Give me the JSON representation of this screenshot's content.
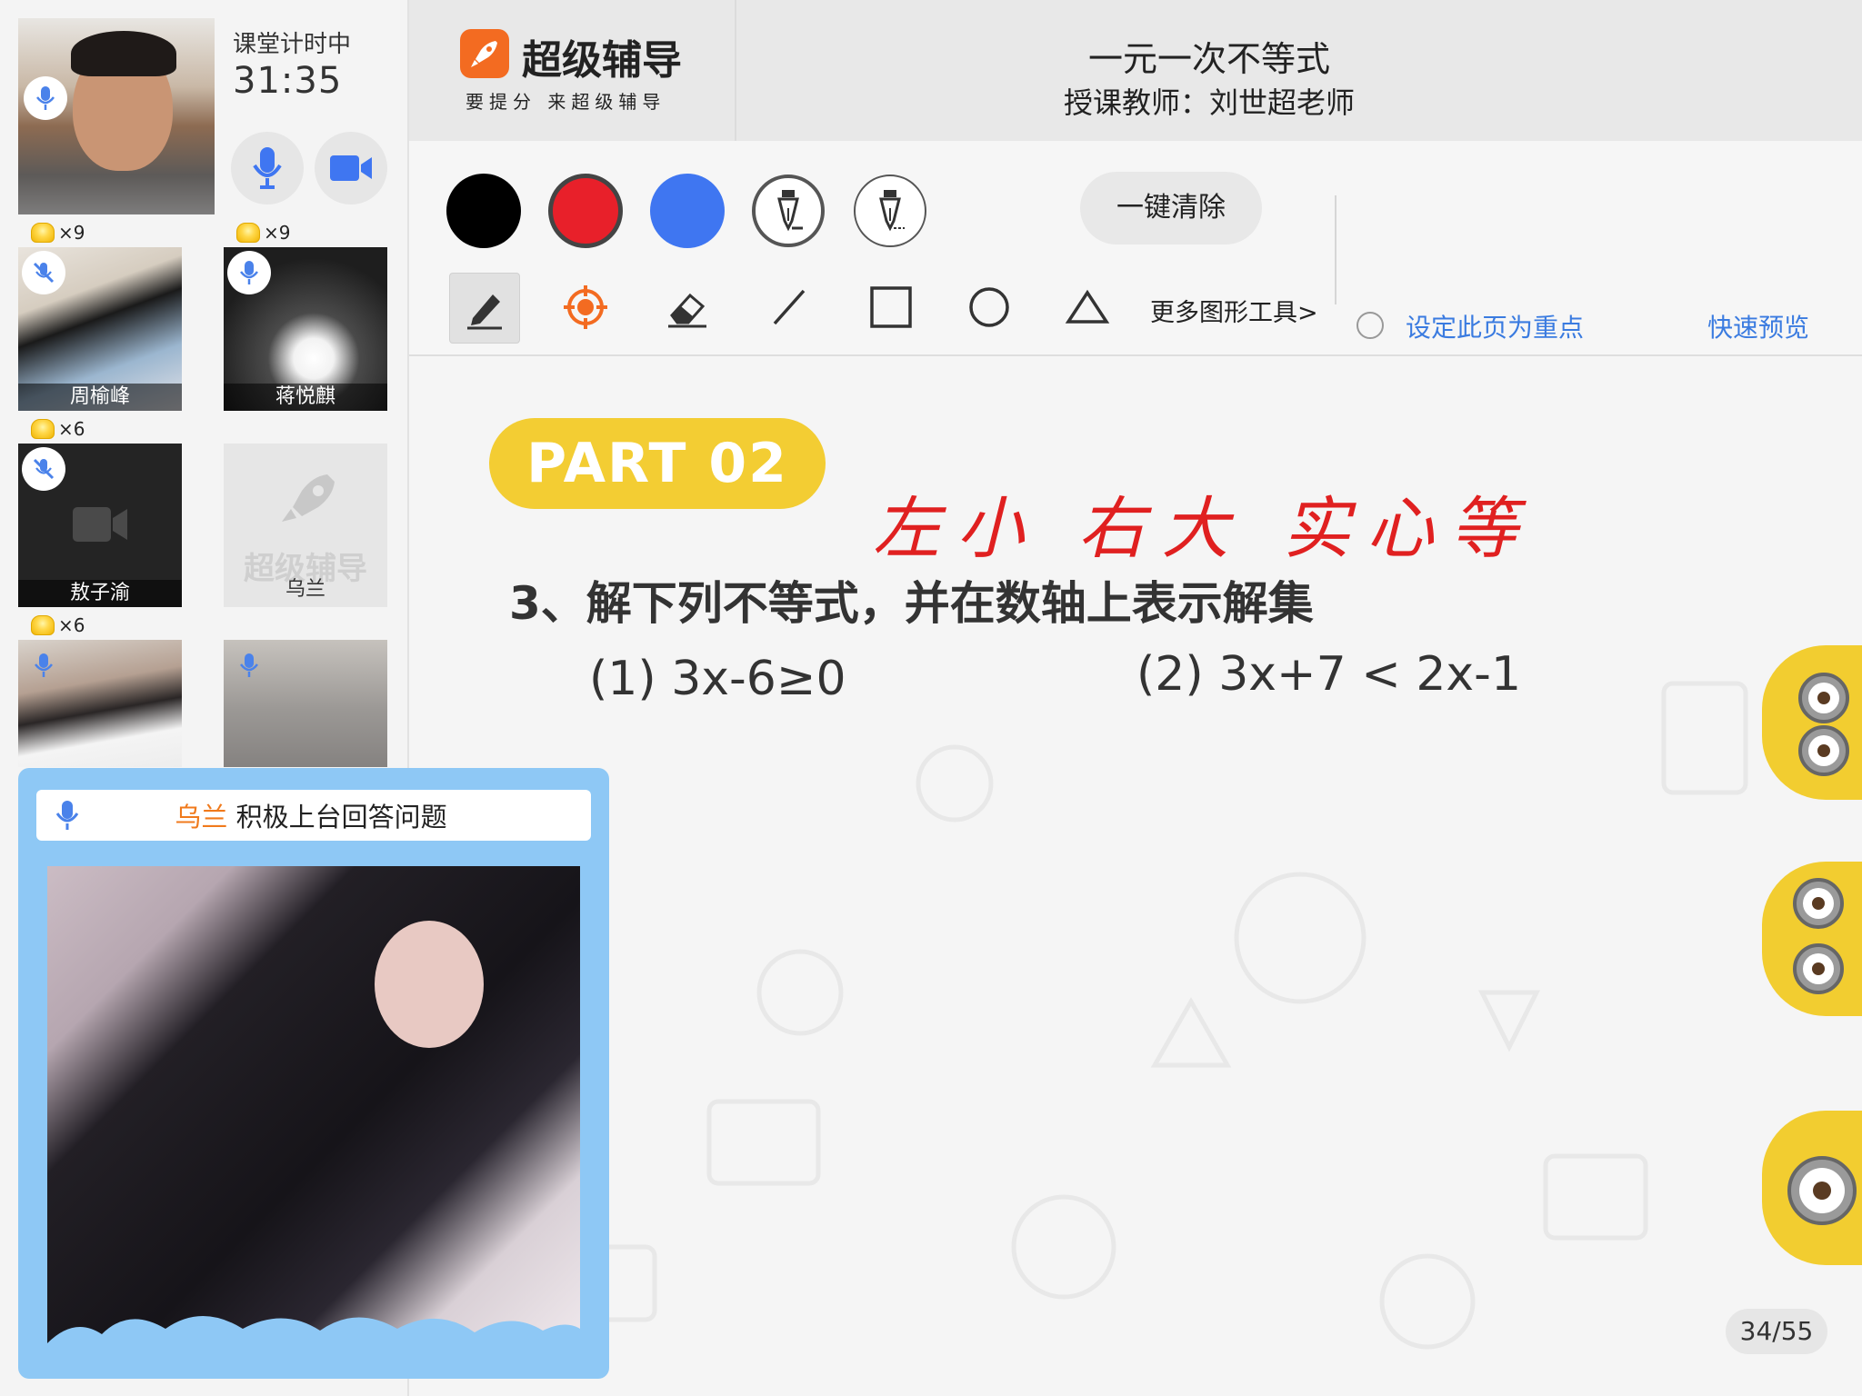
{
  "header": {
    "brand_name": "超级辅导",
    "brand_slogan": "要提分 来超级辅导",
    "lesson_title": "一元一次不等式",
    "teacher": "授课教师：刘世超老师"
  },
  "timer": {
    "label": "课堂计时中",
    "value": "31:35"
  },
  "participants": [
    {
      "name": "",
      "trophies": "×9"
    },
    {
      "name": "周榆峰",
      "trophies": "×9"
    },
    {
      "name": "蒋悦麒",
      "trophies": "×6"
    },
    {
      "name": "敖子渝",
      "trophies": "×6"
    },
    {
      "name": "乌兰",
      "placeholder_text": "超级辅导"
    },
    {
      "name": ""
    },
    {
      "name": ""
    }
  ],
  "answer_popup": {
    "name": "乌兰",
    "message": " 积极上台回答问题"
  },
  "toolbar": {
    "colors": [
      "#000000",
      "#e8202a",
      "#3f76f1"
    ],
    "clear_label": "一键清除",
    "more_shapes_label": "更多图形工具>",
    "mark_label": "设定此页为重点",
    "preview_label": "快速预览"
  },
  "slide": {
    "part_badge": "PART 02",
    "handwriting": "左小 右大 实心等",
    "question": "3、解下列不等式，并在数轴上表示解集",
    "problem_1": "(1) 3x-6≥0",
    "problem_2": "(2) 3x+7 < 2x-1",
    "page_counter": "34/55"
  },
  "icons": {
    "mic": "mic-icon",
    "mic_muted": "mic-muted-icon",
    "camera": "camera-icon",
    "trophy": "trophy-icon",
    "pen": "pen-icon",
    "laser": "laser-pointer-icon",
    "eraser": "eraser-icon",
    "line": "line-icon",
    "rectangle": "rectangle-icon",
    "circle": "circle-icon",
    "triangle": "triangle-icon"
  }
}
